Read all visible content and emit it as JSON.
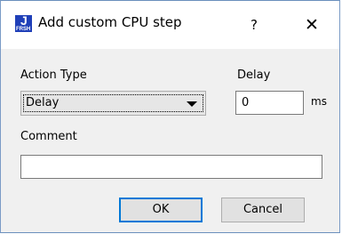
{
  "window": {
    "title": "Add custom CPU step",
    "help_label": "?",
    "close_label": "✕",
    "icon_letter_big": "J",
    "icon_letter_small": "FRSH"
  },
  "form": {
    "action_type_label": "Action Type",
    "action_type_value": "Delay",
    "delay_label": "Delay",
    "delay_value": "0",
    "delay_unit": "ms",
    "comment_label": "Comment",
    "comment_value": ""
  },
  "buttons": {
    "ok": "OK",
    "cancel": "Cancel"
  }
}
